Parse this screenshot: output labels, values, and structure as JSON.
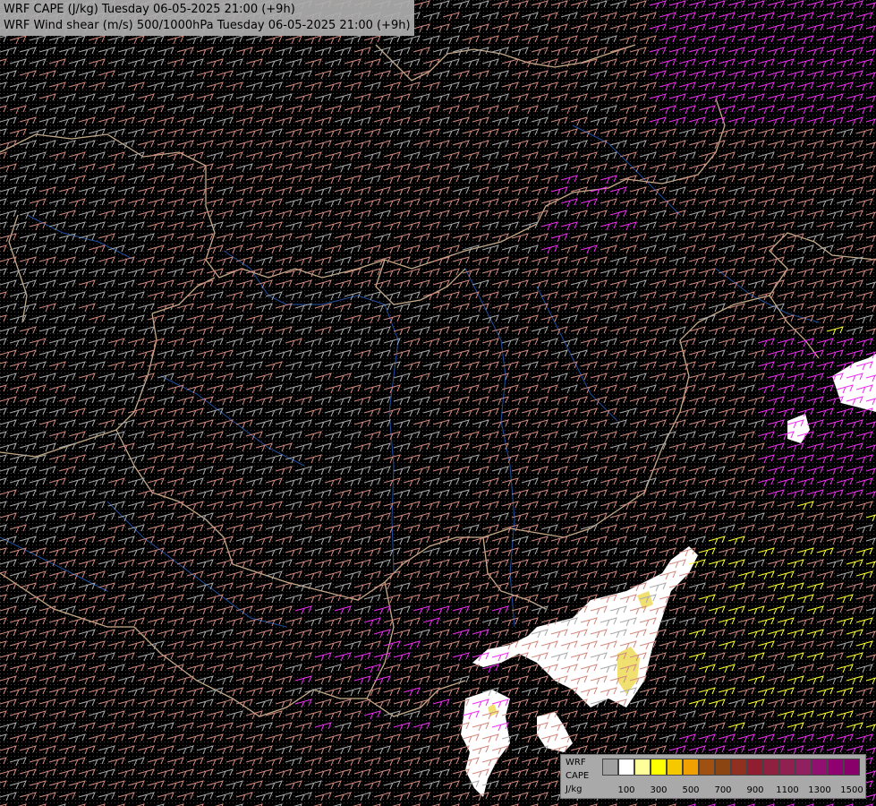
{
  "header": {
    "line1": "WRF CAPE (J/kg) Tuesday 06-05-2025 21:00 (+9h)",
    "line2": "WRF Wind shear (m/s) 500/1000hPa Tuesday 06-05-2025 21:00 (+9h)"
  },
  "legend": {
    "title_lines": [
      "WRF",
      "CAPE",
      "J/kg"
    ],
    "tick_labels": [
      "100",
      "300",
      "500",
      "700",
      "900",
      "1100",
      "1300",
      "1500"
    ],
    "colors": [
      "#a0a0a0",
      "#ffffff",
      "#ffff99",
      "#ffff00",
      "#f5c800",
      "#f0a000",
      "#a05010",
      "#8b4513",
      "#903020",
      "#901e30",
      "#902040",
      "#902050",
      "#902060",
      "#901070",
      "#900070",
      "#8a006a"
    ]
  },
  "colors": {
    "background": "#000000",
    "border": "#e8c8a0",
    "river": "#1e4fa0",
    "barb_low": "#a9a9a9",
    "barb_mid": "#d08a80",
    "barb_high": "#ee30ee",
    "barb_yellow": "#ffff30",
    "cape_white": "#ffffff"
  }
}
